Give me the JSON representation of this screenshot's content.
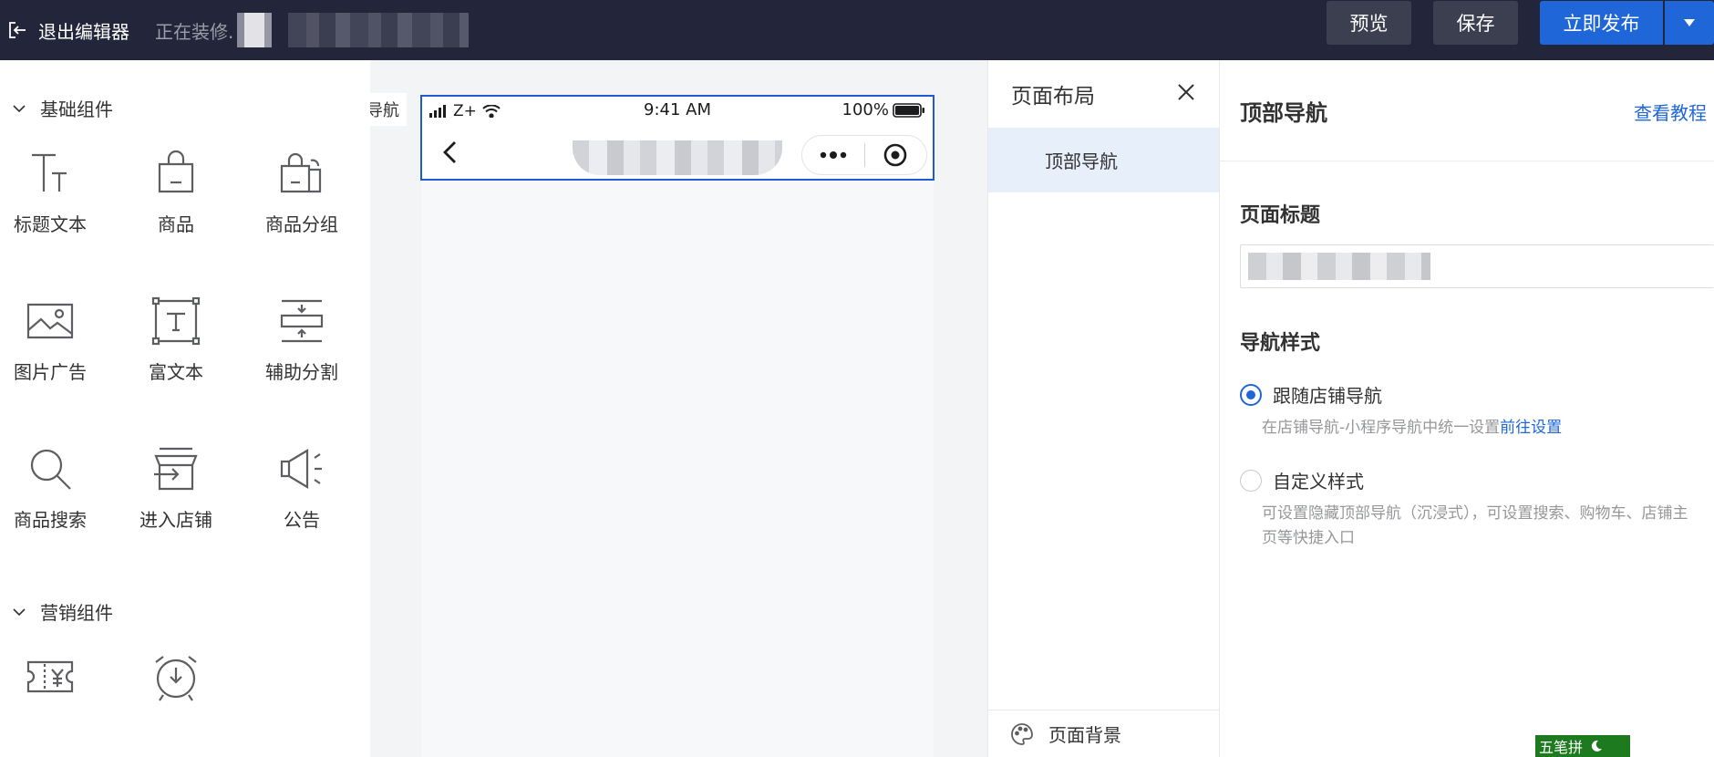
{
  "topbar": {
    "exit_label": "退出编辑器",
    "editing_label": "正在装修.",
    "preview_label": "预览",
    "save_label": "保存",
    "publish_label": "立即发布"
  },
  "left_panel": {
    "basic_title": "基础组件",
    "basic_items": [
      {
        "label": "标题文本",
        "icon": "title-text-icon"
      },
      {
        "label": "商品",
        "icon": "product-bag-icon"
      },
      {
        "label": "商品分组",
        "icon": "product-group-icon"
      },
      {
        "label": "图片广告",
        "icon": "image-ad-icon"
      },
      {
        "label": "富文本",
        "icon": "rich-text-icon"
      },
      {
        "label": "辅助分割",
        "icon": "divider-icon"
      },
      {
        "label": "商品搜索",
        "icon": "search-icon"
      },
      {
        "label": "进入店铺",
        "icon": "store-icon"
      },
      {
        "label": "公告",
        "icon": "megaphone-icon"
      }
    ],
    "marketing_title": "营销组件",
    "marketing_items": [
      {
        "icon": "coupon-icon"
      },
      {
        "icon": "alarm-clock-icon"
      }
    ]
  },
  "canvas": {
    "tab_label": "导航",
    "status_signal": "Z+",
    "status_time": "9:41 AM",
    "status_battery": "100%"
  },
  "layout_panel": {
    "title": "页面布局",
    "item": "顶部导航",
    "bottom": "页面背景"
  },
  "settings": {
    "title": "顶部导航",
    "tutorial": "查看教程",
    "page_title_label": "页面标题",
    "nav_style_label": "导航样式",
    "option1": "跟随店铺导航",
    "option1_hint": "在店铺导航-小程序导航中统一设置",
    "option1_link": "前往设置",
    "option2": "自定义样式",
    "option2_hint": "可设置隐藏顶部导航（沉浸式），可设置搜索、购物车、店铺主页等快捷入口"
  },
  "ime": {
    "label": "五笔拼"
  },
  "colors": {
    "accent": "#1f66d9",
    "topbar": "#23253a",
    "selected_bg": "#e7effb"
  }
}
